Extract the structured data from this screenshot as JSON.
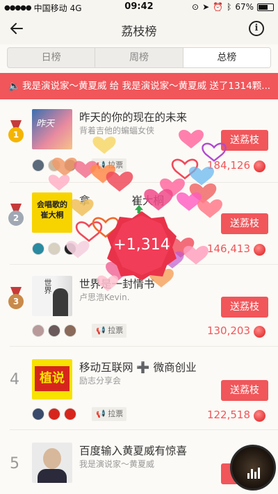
{
  "status": {
    "carrier": "中国移动",
    "network": "4G",
    "time": "09:42",
    "battery": "67%",
    "battery_level": 0.67
  },
  "nav": {
    "title": "荔枝榜",
    "info_glyph": "i"
  },
  "tabs": [
    {
      "label": "日榜",
      "active": false
    },
    {
      "label": "周榜",
      "active": false
    },
    {
      "label": "总榜",
      "active": true
    }
  ],
  "banner": {
    "text": "我是演说家～黄夏威 给 我是演说家～黄夏威 送了1314颗..."
  },
  "rows": [
    {
      "rank": "1",
      "title": "昨天的你的现在的未来",
      "subtitle": "背着吉他的蝙蝠女侠",
      "button": "送荔枝",
      "vote": "拉票",
      "count": "184,126"
    },
    {
      "rank": "2",
      "title": "拿",
      "subtitle": "",
      "button": "送荔枝",
      "vote": "",
      "count": "146,413"
    },
    {
      "rank": "3",
      "title": "世界是一封情书",
      "subtitle": "卢思浩Kevin.",
      "button": "送荔枝",
      "vote": "拉票",
      "count": "130,203"
    },
    {
      "rank": "4",
      "title": "移动互联网 ➕ 微商创业",
      "subtitle": "励志分享会",
      "button": "送荔枝",
      "vote": "拉票",
      "count": "122,518"
    },
    {
      "rank": "5",
      "title": "百度输入黄夏威有惊喜",
      "subtitle": "我是演说家～黄夏威",
      "button": "",
      "vote": "",
      "count": ""
    }
  ],
  "covers": {
    "c1": "昨天",
    "c2": "会唱歌的\n崔大桐",
    "c3": "世界",
    "c4": "植说"
  },
  "partial": {
    "row2_title_tail": "崔大桐"
  },
  "burst": {
    "text": "+1,314"
  },
  "colors": {
    "accent": "#f0565a",
    "gold": "#f5b400",
    "silver": "#a0a8b4",
    "bronze": "#c98a4a"
  }
}
